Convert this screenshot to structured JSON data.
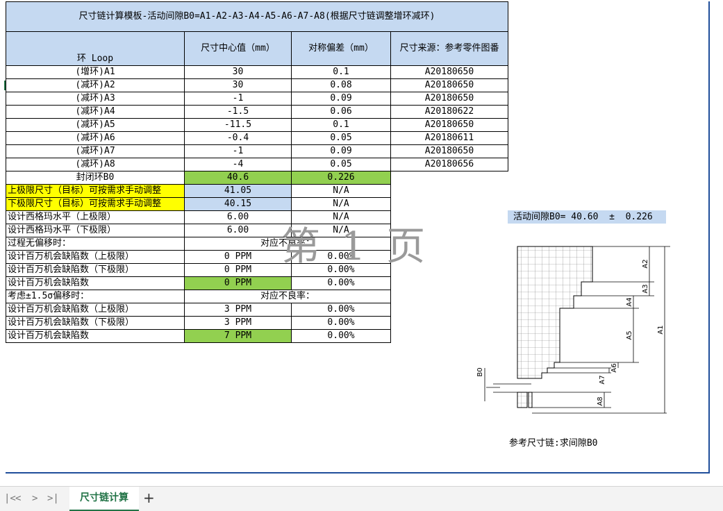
{
  "title": "尺寸链计算模板-活动间隙B0=A1-A2-A3-A4-A5-A6-A7-A8(根据尺寸链调整增环减环)",
  "headers": {
    "loop": "环 Loop",
    "center": "尺寸中心值（mm）",
    "tol": "对称偏差（mm）",
    "source": "尺寸来源：参考零件图番"
  },
  "rows": [
    {
      "label": "(增环)A1",
      "center": "30",
      "tol": "0.1",
      "source": "A20180650"
    },
    {
      "label": "(减环)A2",
      "center": "30",
      "tol": "0.08",
      "source": "A20180650"
    },
    {
      "label": "(减环)A3",
      "center": "-1",
      "tol": "0.09",
      "source": "A20180650"
    },
    {
      "label": "(减环)A4",
      "center": "-1.5",
      "tol": "0.06",
      "source": "A20180622"
    },
    {
      "label": "(减环)A5",
      "center": "-11.5",
      "tol": "0.1",
      "source": "A20180650"
    },
    {
      "label": "(减环)A6",
      "center": "-0.4",
      "tol": "0.05",
      "source": "A20180611"
    },
    {
      "label": "(减环)A7",
      "center": "-1",
      "tol": "0.09",
      "source": "A20180650"
    },
    {
      "label": "(减环)A8",
      "center": "-4",
      "tol": "0.05",
      "source": "A20180656"
    }
  ],
  "closed": {
    "label": "封闭环B0",
    "center": "40.6",
    "tol": "0.226"
  },
  "upper": {
    "label": "上极限尺寸（目标）可按需求手动调整",
    "value": "41.05",
    "na": "N/A"
  },
  "lower": {
    "label": "下极限尺寸（目标）可按需求手动调整",
    "value": "40.15",
    "na": "N/A"
  },
  "sigma_upper": {
    "label": "设计西格玛水平（上极限）",
    "value": "6.00",
    "na": "N/A"
  },
  "sigma_lower": {
    "label": "设计西格玛水平（下极限）",
    "value": "6.00",
    "na": "N/A"
  },
  "no_shift": {
    "label": "过程无偏移时：",
    "rate_label": "对应不良率："
  },
  "ns_upper": {
    "label": "设计百万机会缺陷数（上极限）",
    "ppm": "0 PPM",
    "rate": "0.00%"
  },
  "ns_lower": {
    "label": "设计百万机会缺陷数（下极限）",
    "ppm": "0 PPM",
    "rate": "0.00%"
  },
  "ns_total": {
    "label": "设计百万机会缺陷数",
    "ppm": "0 PPM",
    "rate": "0.00%"
  },
  "shift": {
    "label": "考虑±1.5σ偏移时：",
    "rate_label": "对应不良率："
  },
  "s_upper": {
    "label": "设计百万机会缺陷数（上极限）",
    "ppm": "3 PPM",
    "rate": "0.00%"
  },
  "s_lower": {
    "label": "设计百万机会缺陷数（下极限）",
    "ppm": "3 PPM",
    "rate": "0.00%"
  },
  "s_total": {
    "label": "设计百万机会缺陷数",
    "ppm": "7 PPM",
    "rate": "0.00%"
  },
  "watermark": "第 1 页",
  "b0_result": "活动间隙B0= 40.60  ±  0.226",
  "diagram_labels": {
    "a1": "A1",
    "a2": "A2",
    "a3": "A3",
    "a4": "A4",
    "a5": "A5",
    "a6": "A6",
    "a7": "A7",
    "a8": "A8",
    "b0": "B0"
  },
  "ref_caption": "参考尺寸链:求间隙B0",
  "sheet_tab": "尺寸链计算",
  "add_tab": "+",
  "nav": [
    "|<",
    "<",
    ">",
    ">|"
  ],
  "colors": {
    "header_blue": "#c5d9f1",
    "green": "#92d050",
    "yellow": "#ffff00",
    "tab_green": "#217346"
  }
}
